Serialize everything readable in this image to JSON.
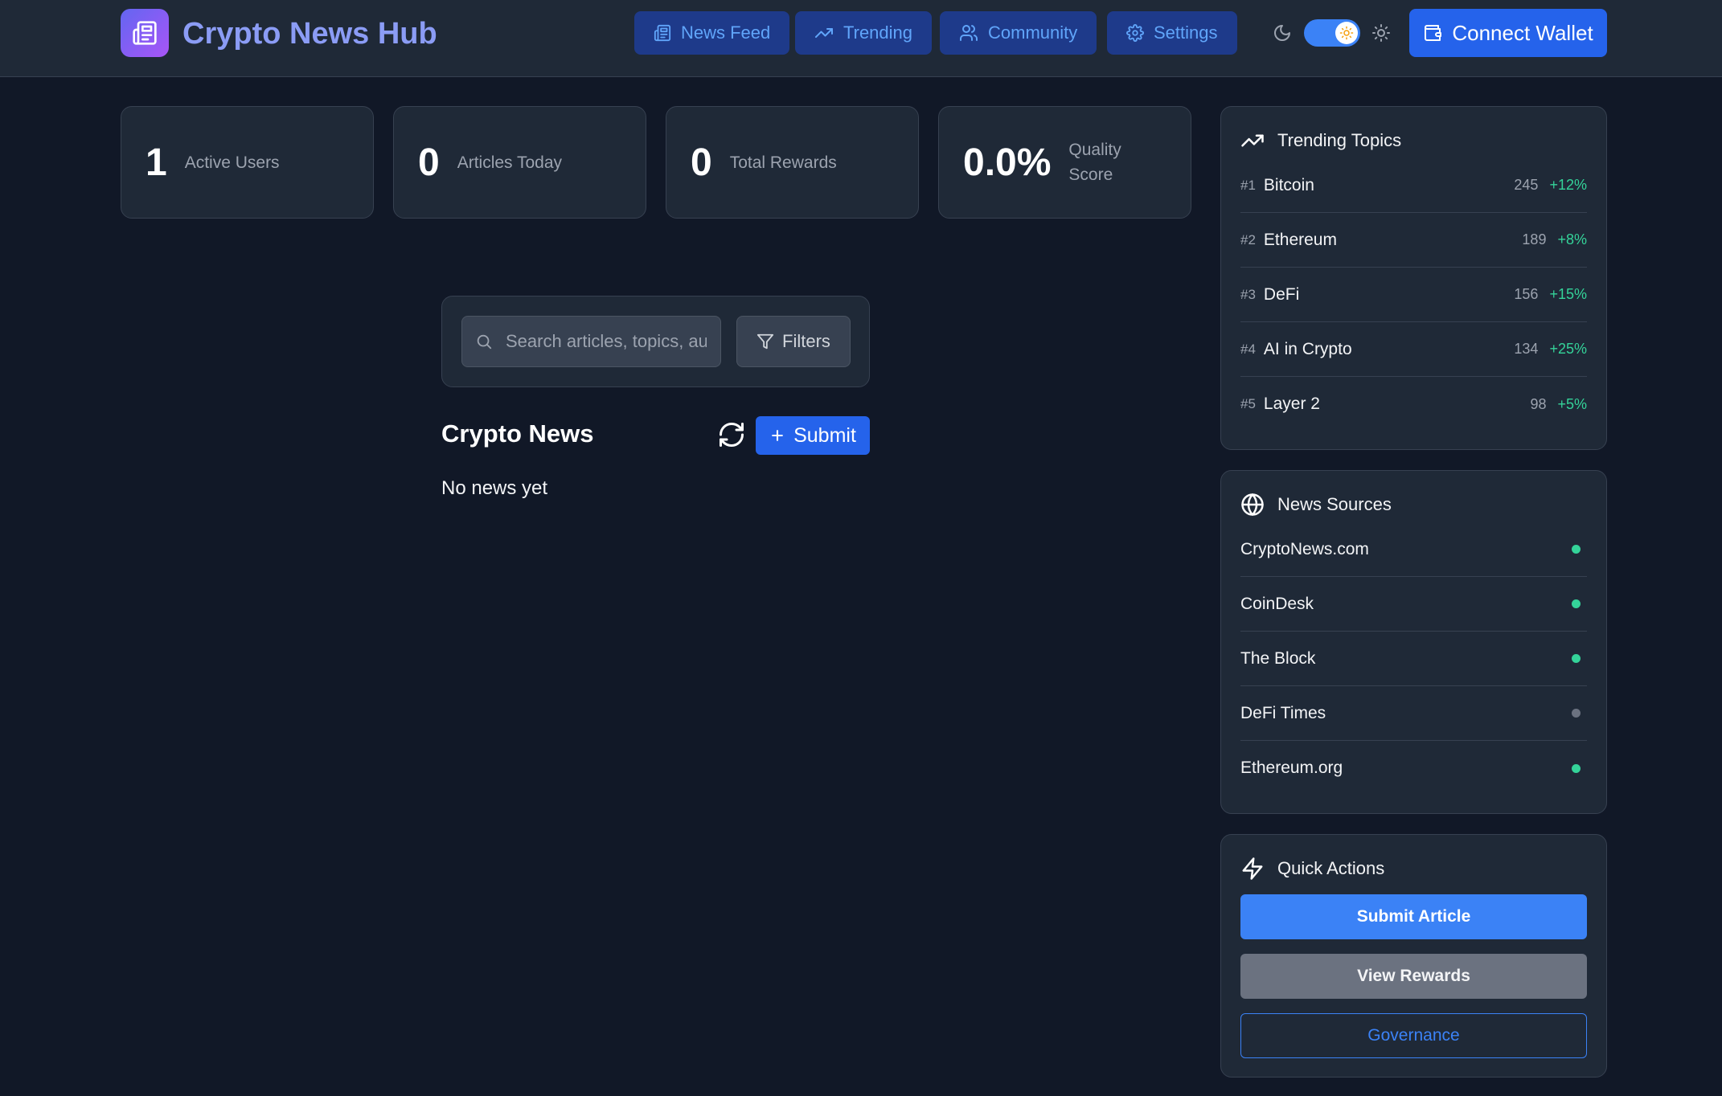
{
  "header": {
    "title": "Crypto News Hub",
    "nav": [
      {
        "label": "News Feed",
        "icon": "newspaper-icon"
      },
      {
        "label": "Trending",
        "icon": "trending-up-icon"
      },
      {
        "label": "Community",
        "icon": "users-icon"
      },
      {
        "label": "Settings",
        "icon": "gear-icon"
      }
    ],
    "connect_label": "Connect Wallet"
  },
  "stats": [
    {
      "value": "1",
      "label": "Active Users"
    },
    {
      "value": "0",
      "label": "Articles Today"
    },
    {
      "value": "0",
      "label": "Total Rewards"
    },
    {
      "value": "0.0%",
      "label": "Quality Score"
    }
  ],
  "search": {
    "placeholder": "Search articles, topics, authors...",
    "filters_label": "Filters"
  },
  "feed": {
    "title": "Crypto News",
    "submit_label": "Submit",
    "empty_text": "No news yet"
  },
  "trending": {
    "title": "Trending Topics",
    "items": [
      {
        "rank": "#1",
        "name": "Bitcoin",
        "count": "245",
        "change": "+12%"
      },
      {
        "rank": "#2",
        "name": "Ethereum",
        "count": "189",
        "change": "+8%"
      },
      {
        "rank": "#3",
        "name": "DeFi",
        "count": "156",
        "change": "+15%"
      },
      {
        "rank": "#4",
        "name": "AI in Crypto",
        "count": "134",
        "change": "+25%"
      },
      {
        "rank": "#5",
        "name": "Layer 2",
        "count": "98",
        "change": "+5%"
      }
    ]
  },
  "sources": {
    "title": "News Sources",
    "items": [
      {
        "name": "CryptoNews.com",
        "status": "active"
      },
      {
        "name": "CoinDesk",
        "status": "active"
      },
      {
        "name": "The Block",
        "status": "active"
      },
      {
        "name": "DeFi Times",
        "status": "inactive"
      },
      {
        "name": "Ethereum.org",
        "status": "active"
      }
    ]
  },
  "quick_actions": {
    "title": "Quick Actions",
    "submit_article": "Submit Article",
    "view_rewards": "View Rewards",
    "governance": "Governance"
  },
  "colors": {
    "background": "#111827",
    "panel": "#1f2937",
    "accent": "#2563eb",
    "positive": "#34d399",
    "inactive": "#6b7280"
  }
}
